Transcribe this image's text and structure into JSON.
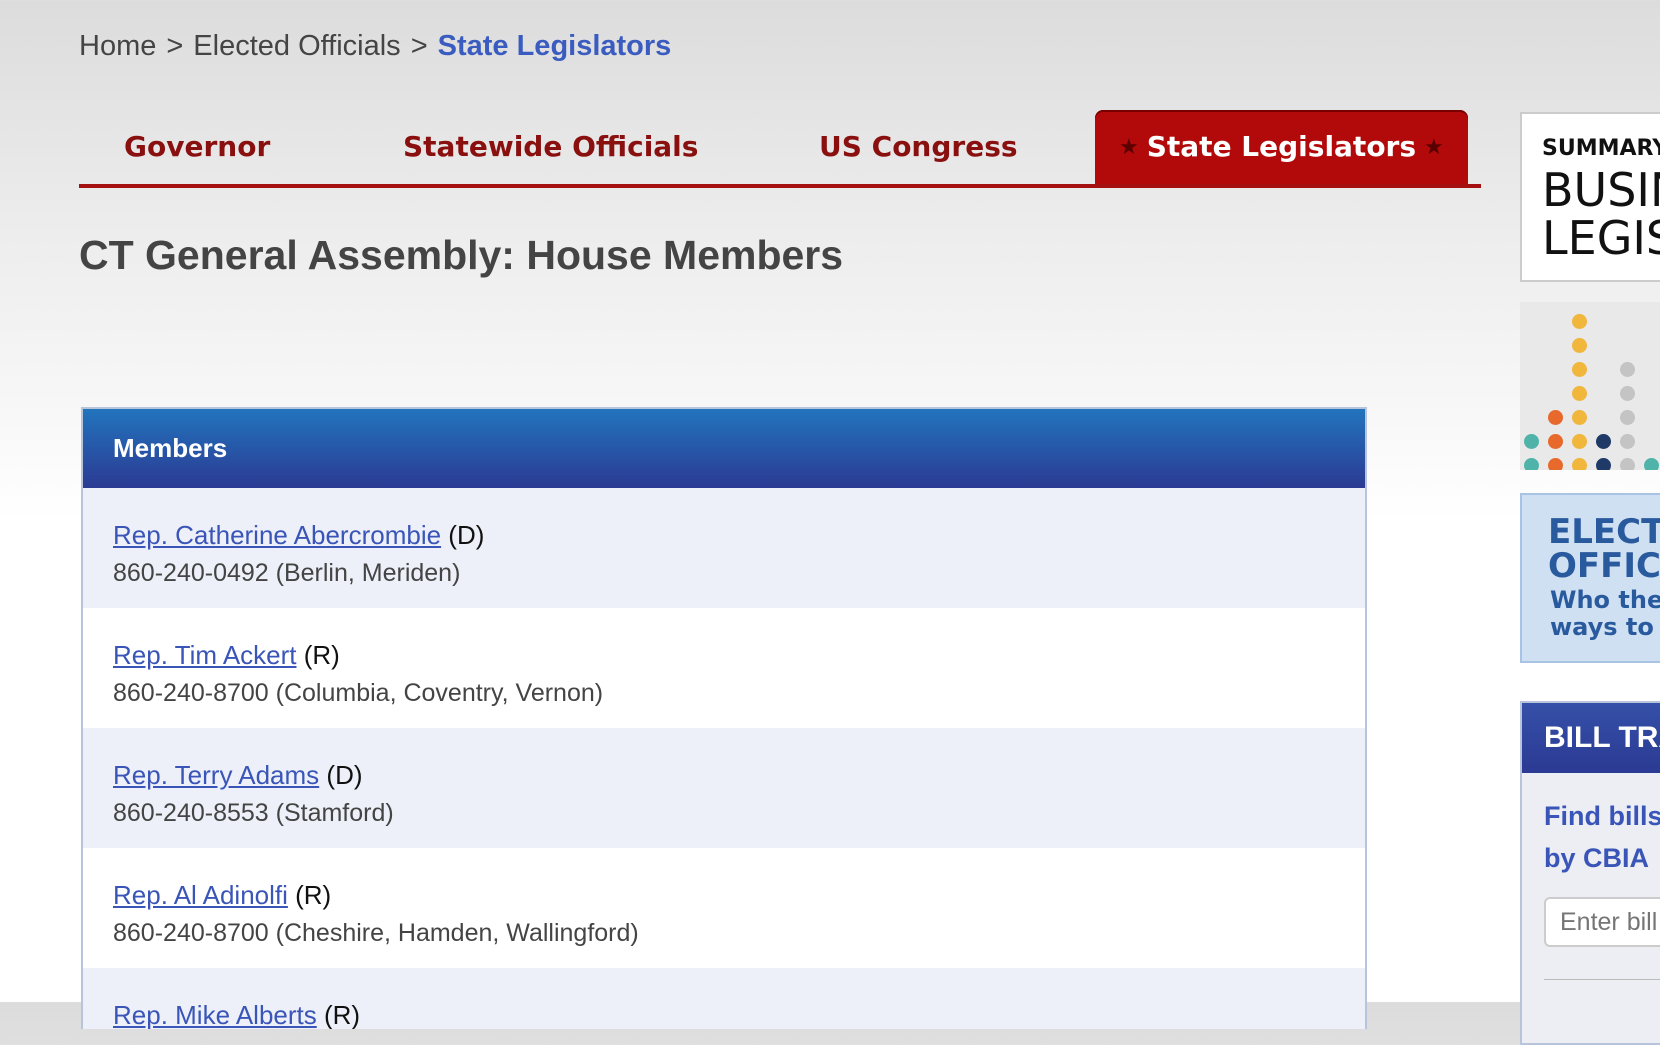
{
  "breadcrumb": {
    "home": "Home",
    "sep1": ">",
    "elected": "Elected Officials",
    "sep2": ">",
    "current": "State Legislators"
  },
  "tabs": [
    {
      "label": "Governor",
      "active": false
    },
    {
      "label": "Statewide Officials",
      "active": false
    },
    {
      "label": "US Congress",
      "active": false
    },
    {
      "label": "State Legislators",
      "active": true,
      "star": "★"
    }
  ],
  "page": {
    "title": "CT General Assembly: House Members"
  },
  "members": {
    "header": "Members",
    "items": [
      {
        "name": "Rep. Catherine Abercrombie",
        "party": "(D)",
        "details": "860-240-0492 (Berlin, Meriden)"
      },
      {
        "name": "Rep. Tim Ackert",
        "party": "(R)",
        "details": "860-240-8700 (Columbia, Coventry, Vernon)"
      },
      {
        "name": "Rep. Terry Adams",
        "party": "(D)",
        "details": "860-240-8553 (Stamford)"
      },
      {
        "name": "Rep. Al Adinolfi",
        "party": "(R)",
        "details": "860-240-8700 (Cheshire, Hamden, Wallingford)"
      },
      {
        "name": "Rep. Mike Alberts",
        "party": "(R)",
        "details": ""
      }
    ]
  },
  "sidebar": {
    "ad1": {
      "line1": "SUMMARY OF",
      "line2": "BUSINESS",
      "line3": "LEGISLATION"
    },
    "ad3": {
      "line1": "ELECTED",
      "line2": "OFFICIALS",
      "line3": "Who they are,",
      "line4": "ways to contact"
    },
    "bill_tracker": {
      "title": "BILL TRACKER",
      "text1": "Find bills",
      "text2": "by CBIA",
      "placeholder": "Enter bill"
    }
  },
  "colors": {
    "accent_red": "#b20a0a",
    "link_blue": "#3a55b8",
    "header_blue": "#2b3a93"
  }
}
